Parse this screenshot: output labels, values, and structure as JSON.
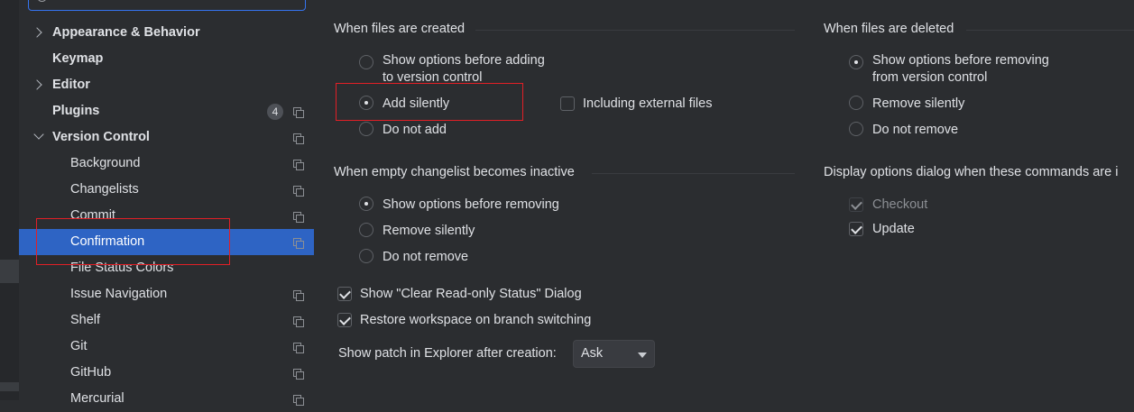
{
  "search": {
    "placeholder": ""
  },
  "sidebar": {
    "items": [
      {
        "label": "Appearance & Behavior",
        "bold": true,
        "chevron": "right"
      },
      {
        "label": "Keymap",
        "bold": true
      },
      {
        "label": "Editor",
        "bold": true,
        "chevron": "right"
      },
      {
        "label": "Plugins",
        "bold": true,
        "badge": "4"
      },
      {
        "label": "Version Control",
        "bold": true,
        "chevron": "down"
      },
      {
        "label": "Background"
      },
      {
        "label": "Changelists"
      },
      {
        "label": "Commit"
      },
      {
        "label": "Confirmation",
        "selected": true
      },
      {
        "label": "File Status Colors"
      },
      {
        "label": "Issue Navigation"
      },
      {
        "label": "Shelf"
      },
      {
        "label": "Git"
      },
      {
        "label": "GitHub"
      },
      {
        "label": "Mercurial"
      }
    ]
  },
  "created": {
    "title": "When files are created",
    "options": [
      {
        "line1": "Show options before adding",
        "line2": "to version control",
        "checked": false
      },
      {
        "label": "Add silently",
        "checked": true
      },
      {
        "label": "Do not add",
        "checked": false
      }
    ],
    "external": {
      "label": "Including external files",
      "checked": false
    }
  },
  "deleted": {
    "title": "When files are deleted",
    "options": [
      {
        "line1": "Show options before removing",
        "line2": "from version control",
        "checked": true
      },
      {
        "label": "Remove silently",
        "checked": false
      },
      {
        "label": "Do not remove",
        "checked": false
      }
    ]
  },
  "changelist": {
    "title": "When empty changelist becomes inactive",
    "options": [
      {
        "label": "Show options before removing",
        "checked": true
      },
      {
        "label": "Remove silently",
        "checked": false
      },
      {
        "label": "Do not remove",
        "checked": false
      }
    ]
  },
  "display": {
    "title": "Display options dialog when these commands are i",
    "options": [
      {
        "label": "Checkout",
        "checked": true,
        "disabled": true
      },
      {
        "label": "Update",
        "checked": true
      }
    ]
  },
  "misc": {
    "clear_readonly": {
      "label": "Show \"Clear Read-only Status\" Dialog",
      "checked": true
    },
    "restore_workspace": {
      "label": "Restore workspace on branch switching",
      "checked": true
    },
    "patch_label": "Show patch in Explorer after creation:",
    "patch_value": "Ask"
  },
  "colors": {
    "accent": "#2e64c4",
    "annotation": "#e21f26",
    "background": "#2b2d30"
  }
}
